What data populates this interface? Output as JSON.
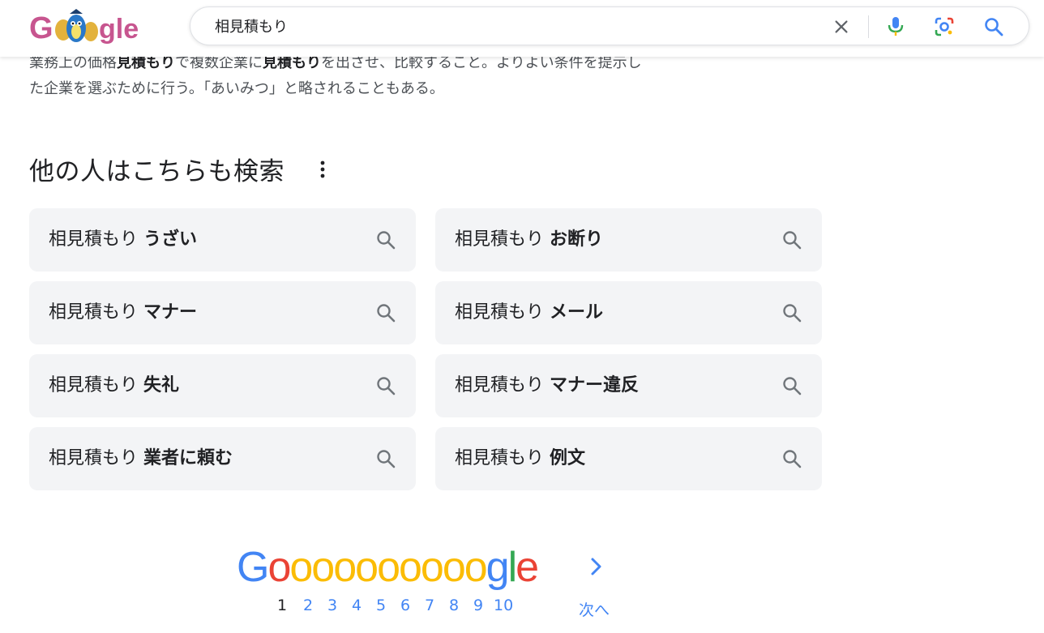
{
  "search": {
    "query": "相見積もり"
  },
  "snippet": {
    "line1_parts": [
      "業務上の価格",
      "見積もり",
      "で複数企業に",
      "見積もり",
      "を出させ、比較すること。よりよい条件を提示し"
    ],
    "line2": "た企業を選ぶために行う。「あいみつ」と略されることもある。"
  },
  "related": {
    "title": "他の人はこちらも検索",
    "items": [
      {
        "base": "相見積もり",
        "suffix": "うざい"
      },
      {
        "base": "相見積もり",
        "suffix": "お断り"
      },
      {
        "base": "相見積もり",
        "suffix": "マナー"
      },
      {
        "base": "相見積もり",
        "suffix": "メール"
      },
      {
        "base": "相見積もり",
        "suffix": "失礼"
      },
      {
        "base": "相見積もり",
        "suffix": "マナー違反"
      },
      {
        "base": "相見積もり",
        "suffix": "業者に頼む"
      },
      {
        "base": "相見積もり",
        "suffix": "例文"
      }
    ]
  },
  "pagination": {
    "pages": [
      "1",
      "2",
      "3",
      "4",
      "5",
      "6",
      "7",
      "8",
      "9",
      "10"
    ],
    "current": "1",
    "next_label": "次へ"
  },
  "colors": {
    "blue": "#4285f4",
    "red": "#ea4335",
    "yellow": "#fbbc05",
    "green": "#34a853",
    "chip_bg": "#f3f4f6"
  }
}
